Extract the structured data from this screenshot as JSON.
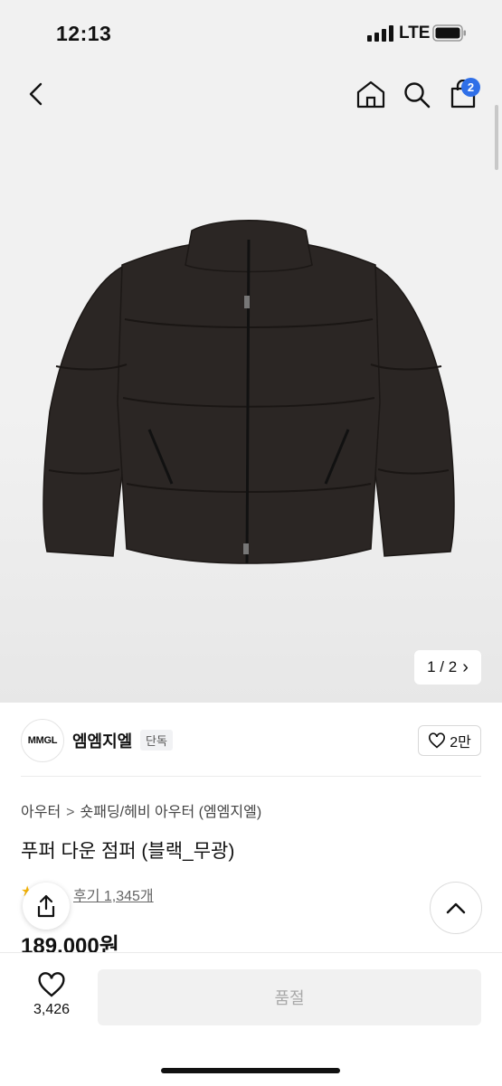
{
  "status_bar": {
    "time": "12:13",
    "network": "LTE"
  },
  "nav": {
    "cart_count": "2"
  },
  "gallery": {
    "pager_text": "1 / 2",
    "pager_arrow": "›"
  },
  "brand": {
    "logo_text": "MMGL",
    "name": "엠엠지엘",
    "exclusive_badge": "단독",
    "like_count": "2만"
  },
  "breadcrumb": {
    "level1": "아우터",
    "separator": ">",
    "level2": "숏패딩/헤비 아우터 (엠엠지엘)"
  },
  "product": {
    "title": "푸퍼 다운 점퍼 (블랙_무광)",
    "rating_partial": "★ .9",
    "review_text": "후기 1,345개",
    "price": "189,000원"
  },
  "bottom_bar": {
    "wishlist_count": "3,426",
    "buy_button": "품절"
  },
  "colors": {
    "badge_blue": "#2f6fe8",
    "star": "#f5b50a",
    "soldout_bg": "#f1f1f1"
  },
  "icons": [
    "back-icon",
    "home-icon",
    "search-icon",
    "cart-icon",
    "heart-icon",
    "share-icon",
    "chevron-up-icon"
  ]
}
